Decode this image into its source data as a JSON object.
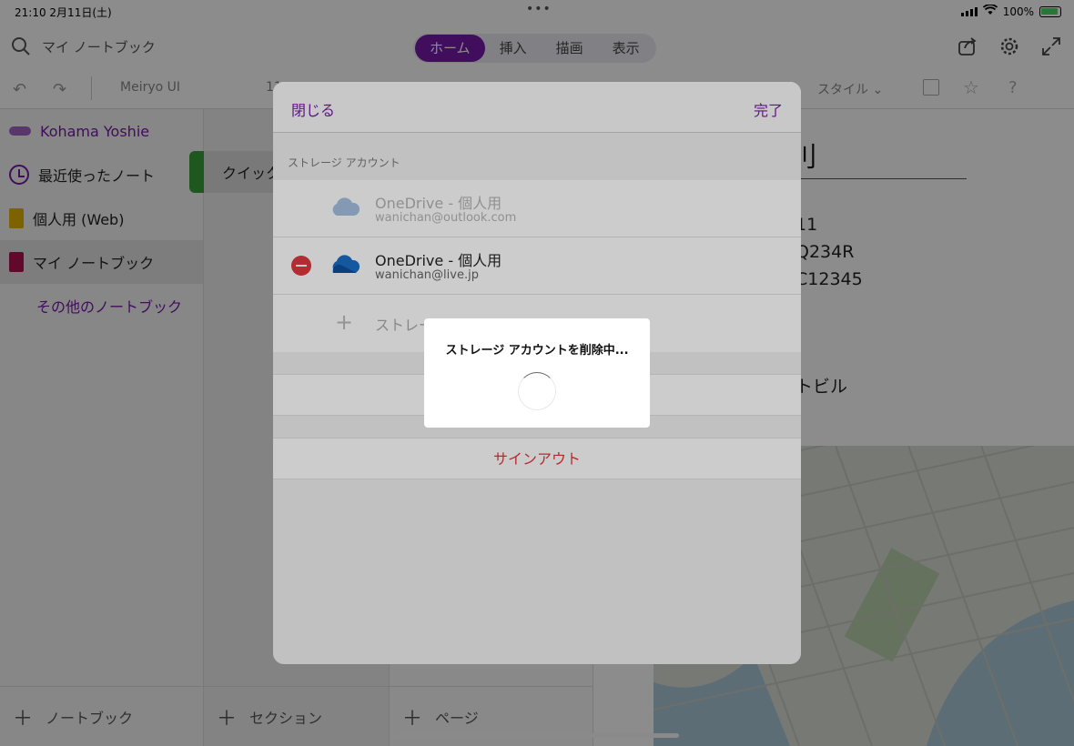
{
  "status_bar": {
    "time": "21:10",
    "date": "2月11日(土)",
    "battery": "100%"
  },
  "top_bar": {
    "search_label": "マイ ノートブック",
    "tabs": [
      {
        "label": "ホーム",
        "active": true
      },
      {
        "label": "挿入",
        "active": false
      },
      {
        "label": "描画",
        "active": false
      },
      {
        "label": "表示",
        "active": false
      }
    ]
  },
  "ribbon": {
    "font_name": "Meiryo UI",
    "font_size": "11",
    "style_label": "スタイル"
  },
  "sidebar": {
    "user_name": "Kohama Yoshie",
    "items": [
      {
        "label": "最近使ったノート"
      },
      {
        "label": "個人用 (Web)"
      },
      {
        "label": "マイ ノートブック"
      }
    ],
    "other_notebooks": "その他のノートブック",
    "add_notebook": "ノートブック"
  },
  "sections": {
    "current": "クイック",
    "add_section": "セクション"
  },
  "pages": {
    "add_page": "ページ"
  },
  "note": {
    "title_fragment": "刂",
    "lines": [
      "11",
      "Q234R",
      "C12345",
      "トビル"
    ]
  },
  "sheet": {
    "close_label": "閉じる",
    "done_label": "完了",
    "group_title": "ストレージ アカウント",
    "accounts": [
      {
        "name": "OneDrive - 個人用",
        "email": "wanichan@outlook.com"
      },
      {
        "name": "OneDrive - 個人用",
        "email": "wanichan@live.jp"
      }
    ],
    "add_account_label": "ストレー",
    "sign_out_label": "サインアウト"
  },
  "alert": {
    "message": "ストレージ アカウントを削除中..."
  },
  "colors": {
    "accent": "#7719aa",
    "destructive": "#e0383e",
    "section_tab": "#3aa03a"
  }
}
